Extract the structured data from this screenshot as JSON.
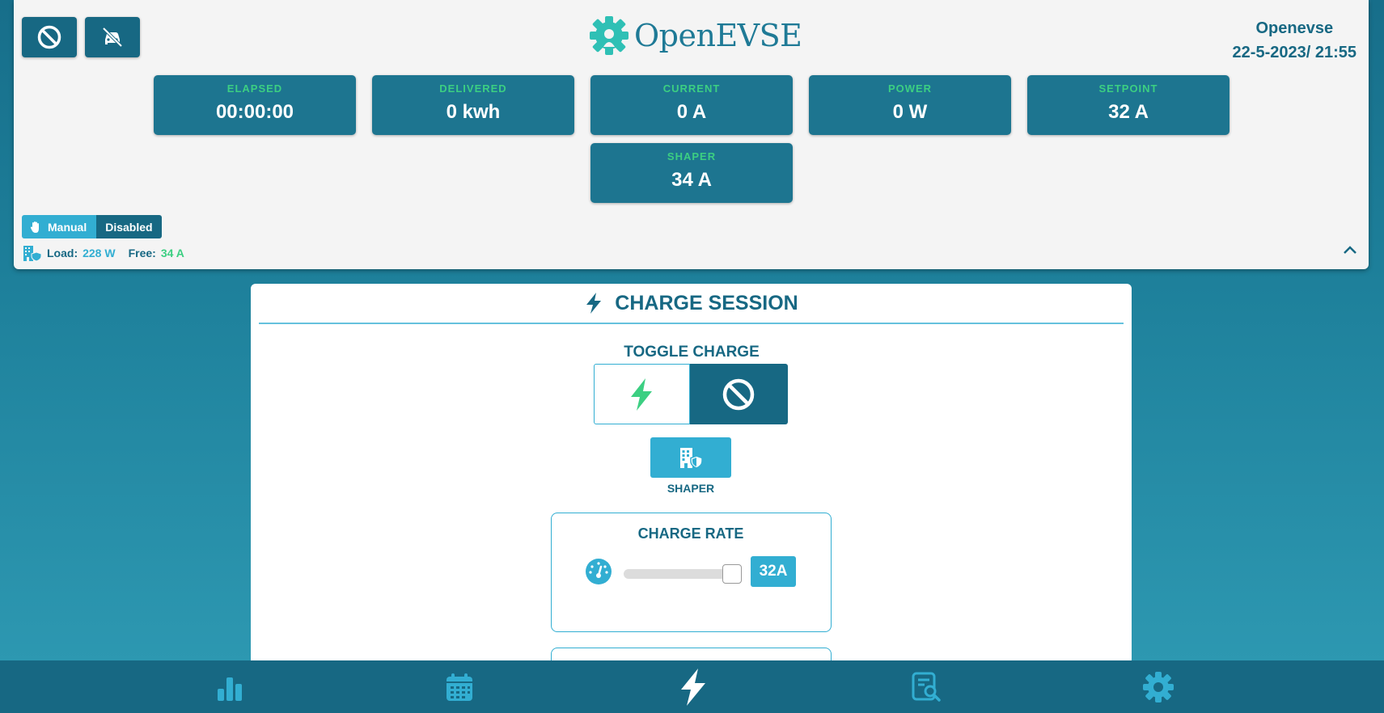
{
  "header": {
    "logo_text": "OpenEVSE",
    "device_name": "Openevse",
    "datetime": "22-5-2023/ 21:55",
    "buttons": [
      {
        "icon": "ban-icon"
      },
      {
        "icon": "car-off-icon"
      }
    ],
    "stats": [
      {
        "label": "ELAPSED",
        "value": "00:00:00"
      },
      {
        "label": "DELIVERED",
        "value": "0 kwh"
      },
      {
        "label": "CURRENT",
        "value": "0 A"
      },
      {
        "label": "POWER",
        "value": "0 W"
      },
      {
        "label": "SETPOINT",
        "value": "32 A"
      },
      {
        "label": "SHAPER",
        "value": "34 A"
      }
    ],
    "mode": {
      "manual": "Manual",
      "disabled": "Disabled"
    },
    "load": {
      "load_label": "Load:",
      "load_value": "228 W",
      "free_label": "Free:",
      "free_value": "34 A"
    }
  },
  "session": {
    "title": "CHARGE SESSION",
    "toggle_label": "TOGGLE CHARGE",
    "shaper_label": "SHAPER",
    "charge_rate_label": "CHARGE RATE",
    "charge_rate_value": "32A",
    "charge_rate_level": 1.0
  },
  "nav": {
    "items": [
      "stats-icon",
      "calendar-icon",
      "bolt-icon",
      "logs-icon",
      "gear-icon"
    ]
  },
  "colors": {
    "primary": "#176883",
    "accent": "#32aed2",
    "green": "#3ccf82",
    "background": "#1d7f9a"
  }
}
